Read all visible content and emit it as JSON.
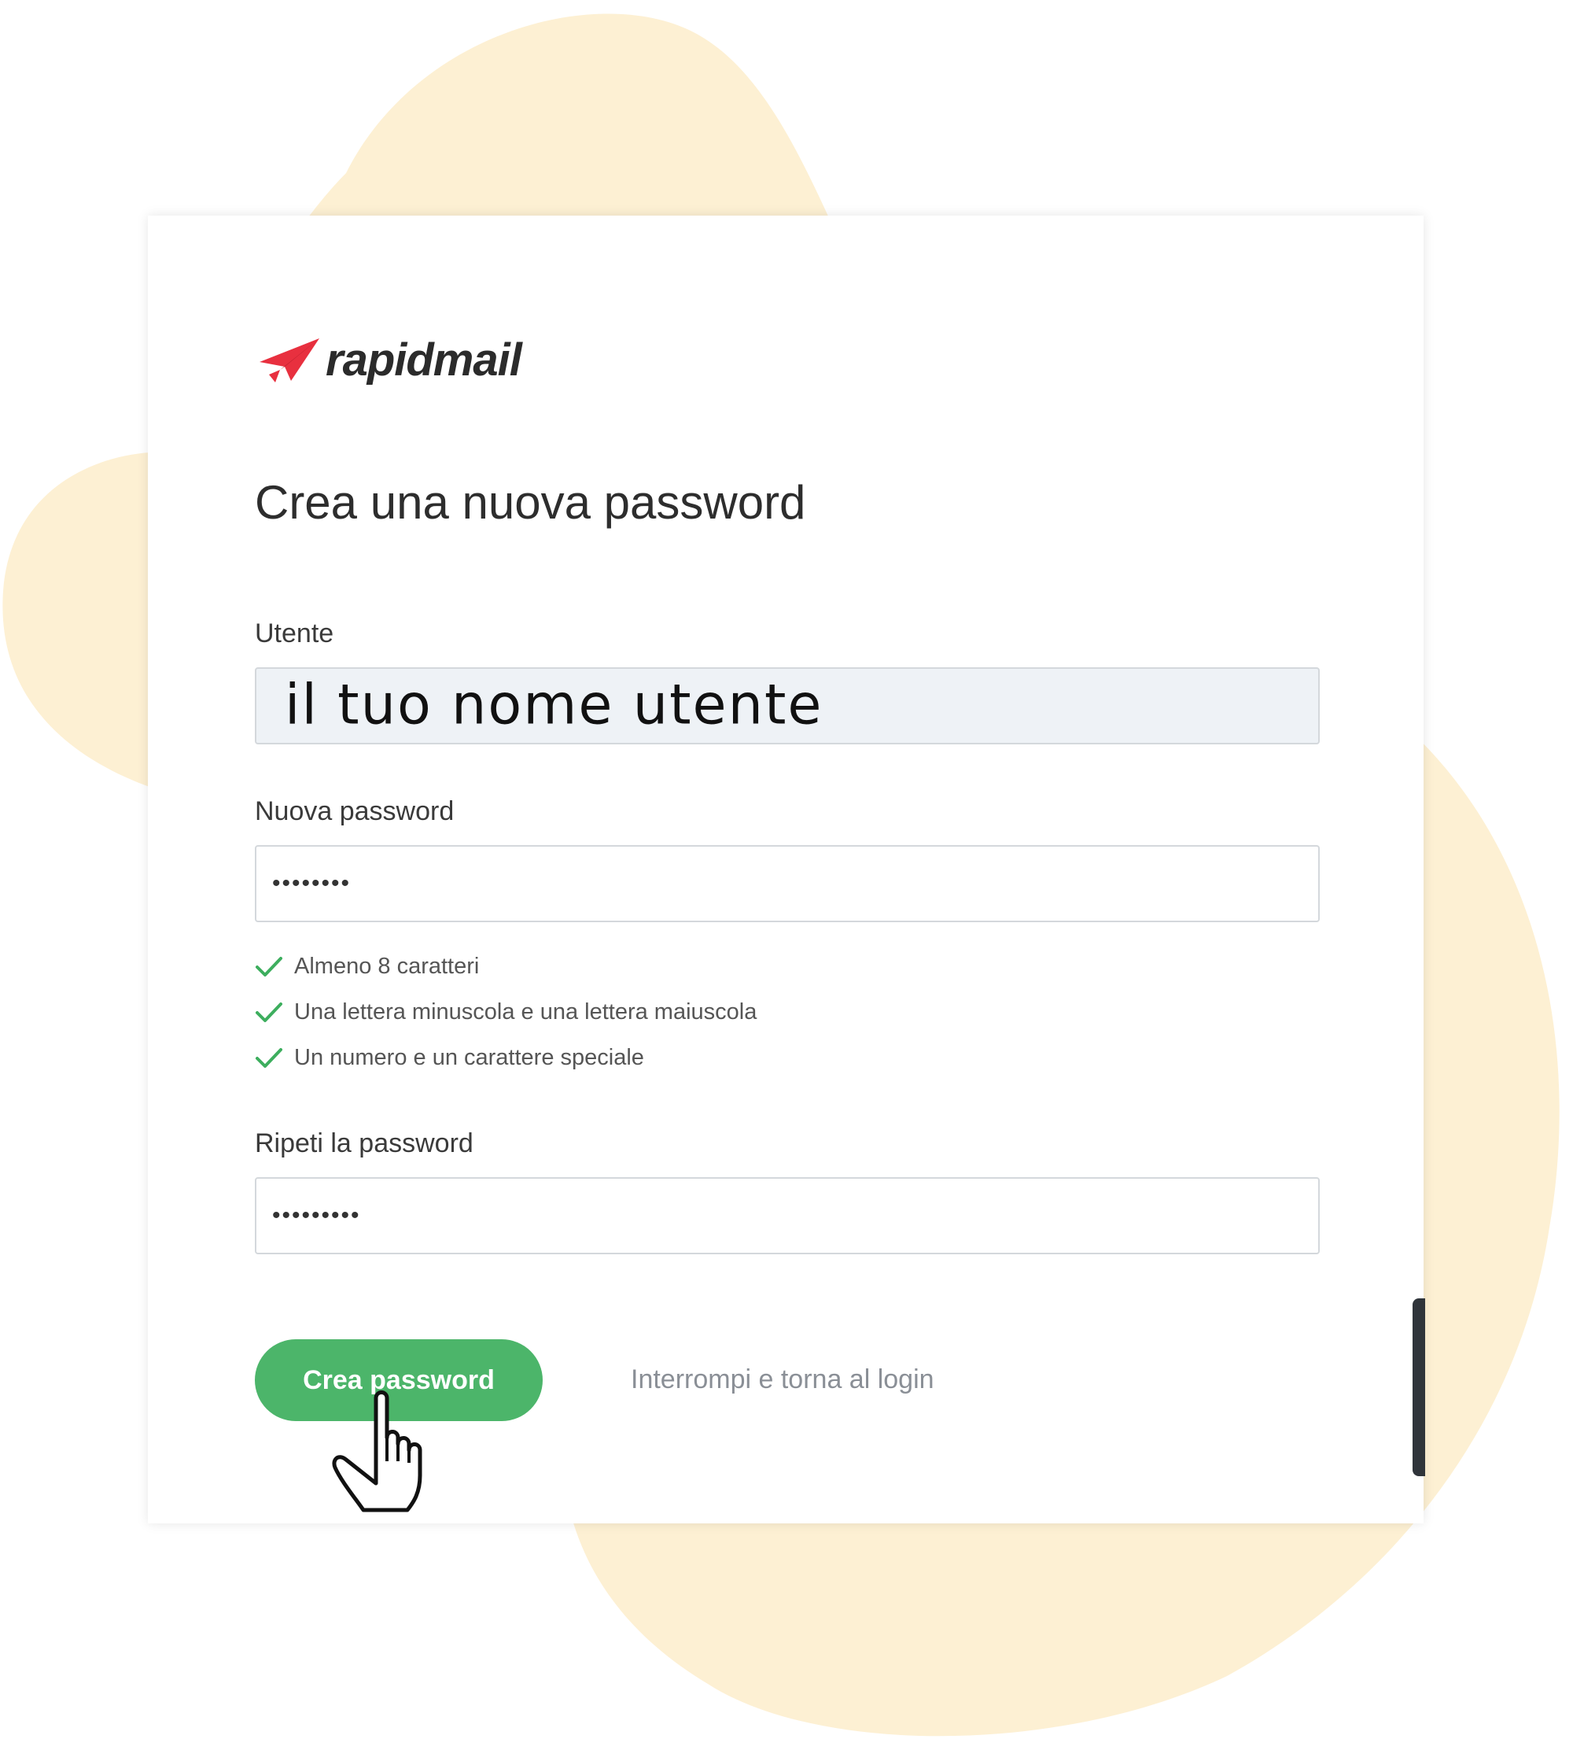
{
  "brand": {
    "name": "rapidmail",
    "accent_color": "#e8303f"
  },
  "page": {
    "title": "Crea una nuova password",
    "background_blob_color": "#fdf0d3"
  },
  "form": {
    "user": {
      "label": "Utente",
      "value": "il tuo nome utente",
      "disabled": true
    },
    "new_password": {
      "label": "Nuova password",
      "value": "••••••••"
    },
    "requirements": [
      {
        "text": "Almeno 8 caratteri",
        "met": true,
        "icon": "check-icon"
      },
      {
        "text": "Una lettera minuscola e una lettera maiuscola",
        "met": true,
        "icon": "check-icon"
      },
      {
        "text": "Un numero e un carattere speciale",
        "met": true,
        "icon": "check-icon"
      }
    ],
    "repeat_password": {
      "label": "Ripeti la password",
      "value": "•••••••••"
    }
  },
  "actions": {
    "submit_label": "Crea password",
    "cancel_label": "Interrompi e torna al login",
    "primary_color": "#4cb56a",
    "check_color": "#3dae5e"
  }
}
